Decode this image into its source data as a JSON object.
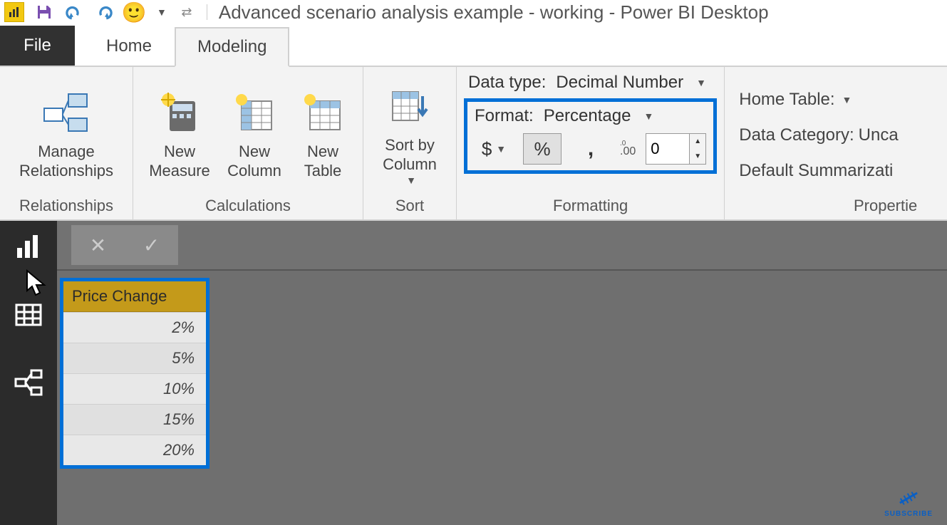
{
  "window_title": "Advanced scenario analysis example - working - Power BI Desktop",
  "tabs": {
    "file": "File",
    "home": "Home",
    "modeling": "Modeling"
  },
  "ribbon": {
    "relationships": {
      "manage": "Manage\nRelationships",
      "group_label": "Relationships"
    },
    "calculations": {
      "new_measure": "New\nMeasure",
      "new_column": "New\nColumn",
      "new_table": "New\nTable",
      "group_label": "Calculations"
    },
    "sort": {
      "sort_by_column": "Sort by\nColumn",
      "group_label": "Sort"
    },
    "formatting": {
      "data_type_label": "Data type:",
      "data_type_value": "Decimal Number",
      "format_label": "Format:",
      "format_value": "Percentage",
      "currency_symbol": "$",
      "percent_symbol": "%",
      "thousands_symbol": ",",
      "decimal_icon": ".00",
      "decimal_places": "0",
      "group_label": "Formatting"
    },
    "properties": {
      "home_table_label": "Home Table:",
      "data_category_label": "Data Category:",
      "data_category_value": "Unca",
      "default_summarization_label": "Default Summarizati",
      "group_label": "Propertie"
    }
  },
  "table": {
    "header": "Price Change",
    "rows": [
      "2%",
      "5%",
      "10%",
      "15%",
      "20%"
    ]
  },
  "subscribe": "SUBSCRIBE"
}
